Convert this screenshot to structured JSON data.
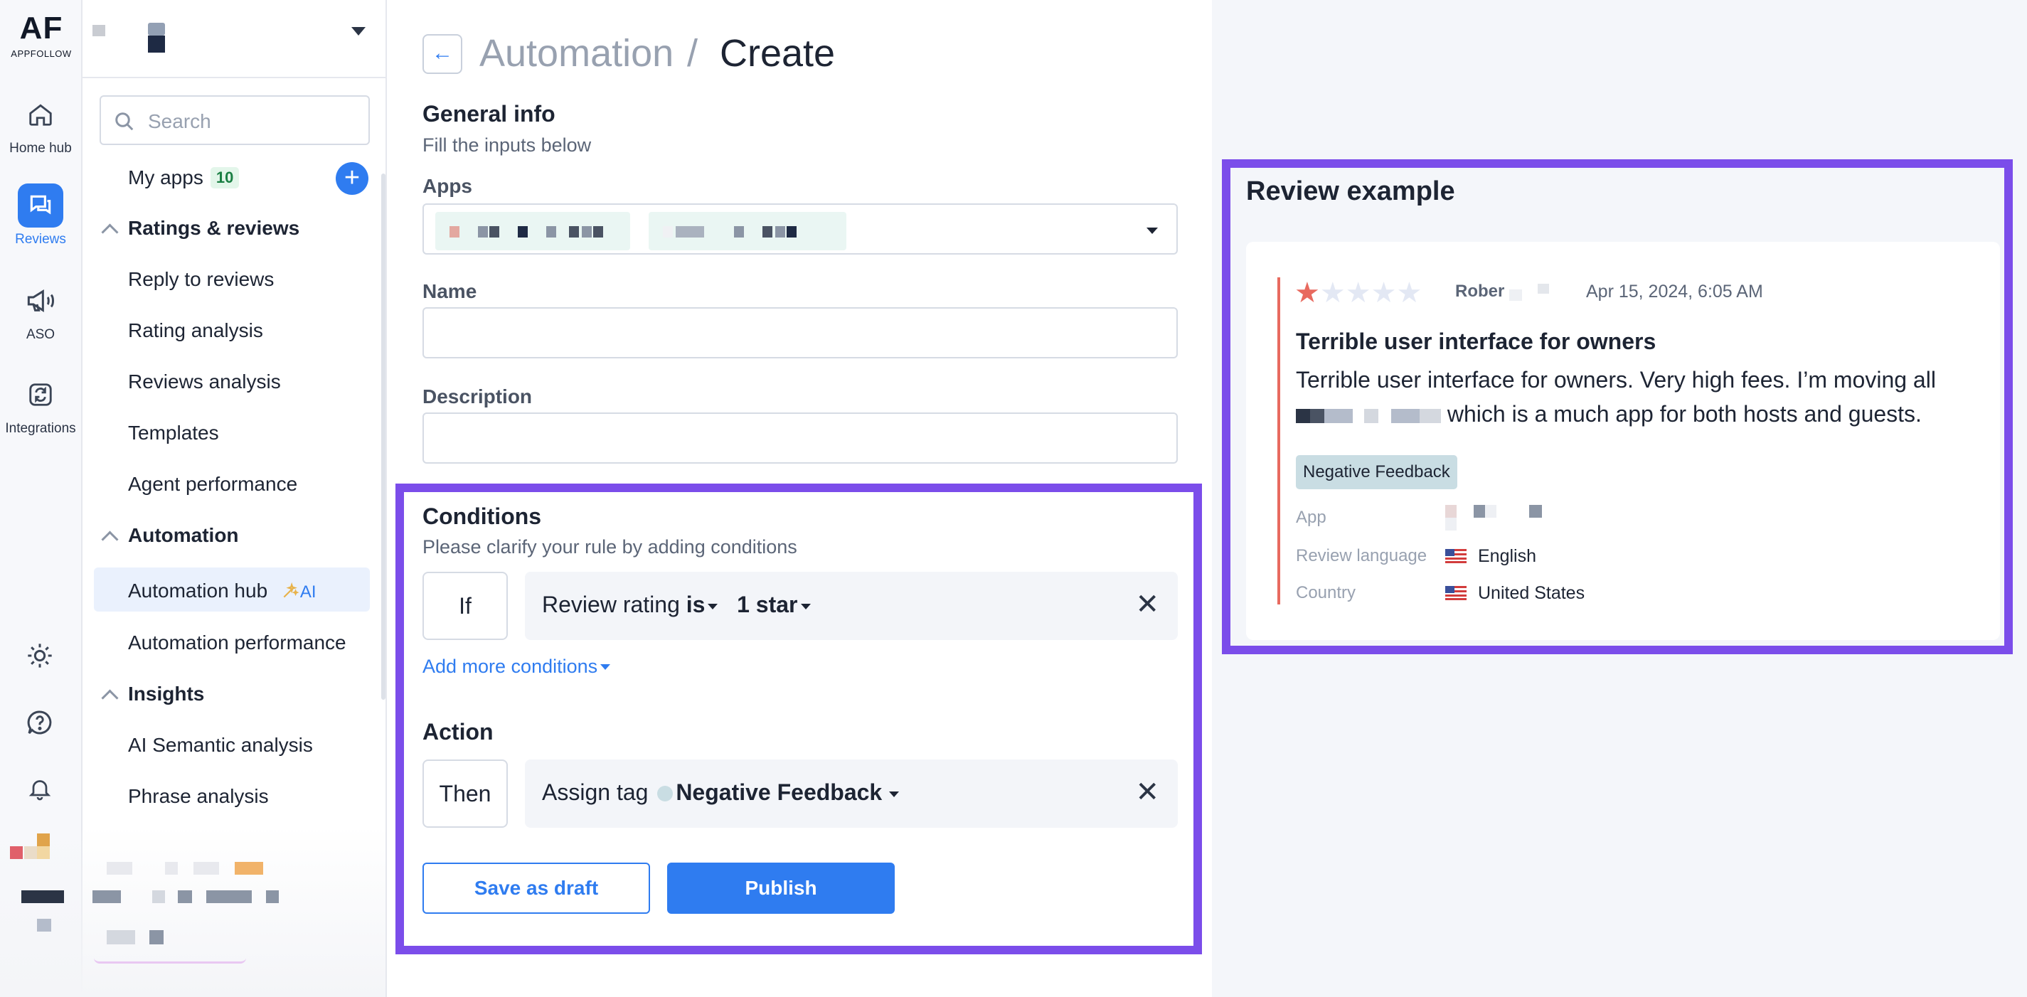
{
  "brand": {
    "logo_main": "AF",
    "logo_sub": "APPFOLLOW"
  },
  "rail": {
    "items": [
      {
        "label": "Home hub",
        "icon": "home-icon"
      },
      {
        "label": "Reviews",
        "icon": "reviews-chat-icon",
        "active": true
      },
      {
        "label": "ASO",
        "icon": "megaphone-icon"
      },
      {
        "label": "Integrations",
        "icon": "integrations-icon"
      }
    ],
    "bottom_icons": [
      "sun-icon",
      "help-icon",
      "bell-icon"
    ]
  },
  "sidebar": {
    "search_placeholder": "Search",
    "my_apps_label": "My apps",
    "my_apps_count": "10",
    "sections": [
      {
        "title": "Ratings & reviews",
        "items": [
          "Reply to reviews",
          "Rating analysis",
          "Reviews analysis",
          "Templates",
          "Agent performance"
        ]
      },
      {
        "title": "Automation",
        "items": [
          "Automation hub",
          "Automation performance"
        ],
        "active_item": "Automation hub",
        "active_badge": "AI"
      },
      {
        "title": "Insights",
        "items": [
          "AI Semantic analysis",
          "Phrase analysis"
        ]
      }
    ]
  },
  "header": {
    "breadcrumb_parent": "Automation",
    "separator": "/",
    "current": "Create"
  },
  "general": {
    "title": "General info",
    "subtitle": "Fill the inputs below",
    "apps_label": "Apps",
    "name_label": "Name",
    "name_value": "",
    "description_label": "Description",
    "description_value": ""
  },
  "conditions": {
    "title": "Conditions",
    "subtitle": "Please clarify your rule by adding conditions",
    "if_label": "If",
    "field": "Review rating",
    "operator": "is",
    "value": "1 star",
    "add_more": "Add more conditions"
  },
  "action": {
    "title": "Action",
    "then_label": "Then",
    "verb": "Assign tag",
    "tag": "Negative Feedback"
  },
  "buttons": {
    "save_draft": "Save as draft",
    "publish": "Publish"
  },
  "review_example": {
    "title": "Review example",
    "rating": 1,
    "rating_max": 5,
    "author": "Rober",
    "date": "Apr 15, 2024, 6:05 AM",
    "headline": "Terrible user interface for owners",
    "body_line1": "Terrible user interface for owners. Very high fees. I’m moving all",
    "body_line2_tail": "which is a much app for both hosts and guests.",
    "tag": "Negative Feedback",
    "meta": {
      "app_label": "App",
      "language_label": "Review language",
      "language_value": "English",
      "country_label": "Country",
      "country_value": "United States"
    }
  },
  "colors": {
    "accent": "#2f7cf0",
    "highlight": "#7b4dea",
    "star_filled": "#e86a5f",
    "star_empty": "#e3e8f4"
  }
}
